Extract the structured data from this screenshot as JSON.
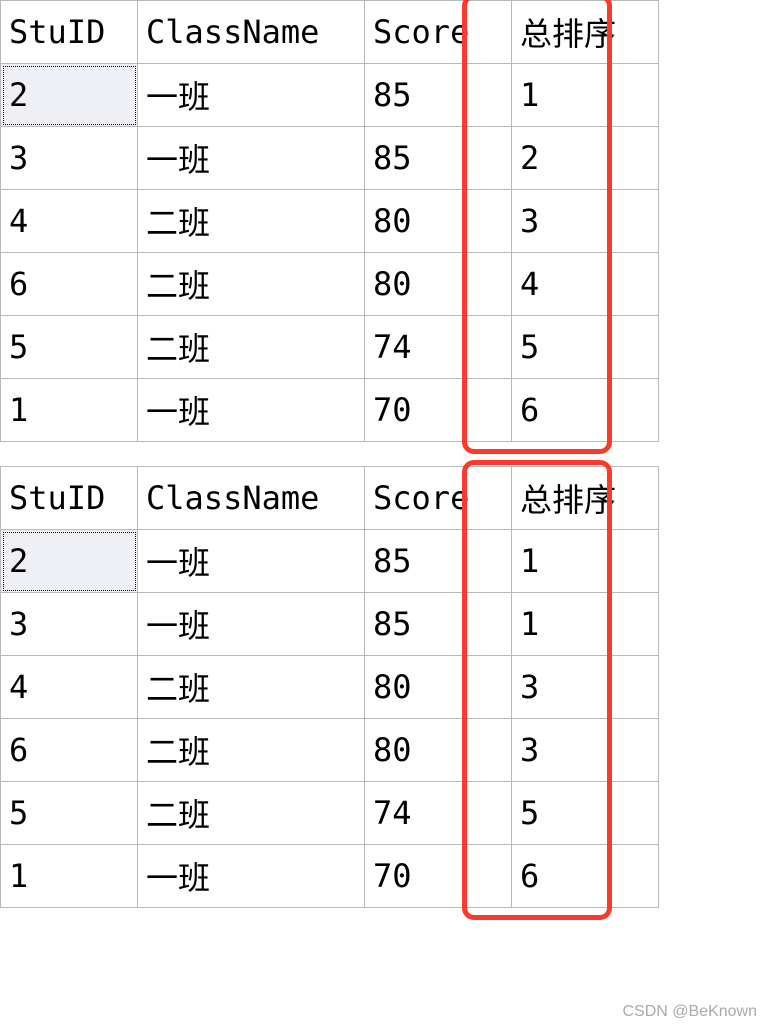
{
  "table1": {
    "headers": [
      "StuID",
      "ClassName",
      "Score",
      "总排序"
    ],
    "rows": [
      {
        "StuID": "2",
        "ClassName": "一班",
        "Score": "85",
        "Rank": "1"
      },
      {
        "StuID": "3",
        "ClassName": "一班",
        "Score": "85",
        "Rank": "2"
      },
      {
        "StuID": "4",
        "ClassName": "二班",
        "Score": "80",
        "Rank": "3"
      },
      {
        "StuID": "6",
        "ClassName": "二班",
        "Score": "80",
        "Rank": "4"
      },
      {
        "StuID": "5",
        "ClassName": "二班",
        "Score": "74",
        "Rank": "5"
      },
      {
        "StuID": "1",
        "ClassName": "一班",
        "Score": "70",
        "Rank": "6"
      }
    ]
  },
  "table2": {
    "headers": [
      "StuID",
      "ClassName",
      "Score",
      "总排序"
    ],
    "rows": [
      {
        "StuID": "2",
        "ClassName": "一班",
        "Score": "85",
        "Rank": "1"
      },
      {
        "StuID": "3",
        "ClassName": "一班",
        "Score": "85",
        "Rank": "1"
      },
      {
        "StuID": "4",
        "ClassName": "二班",
        "Score": "80",
        "Rank": "3"
      },
      {
        "StuID": "6",
        "ClassName": "二班",
        "Score": "80",
        "Rank": "3"
      },
      {
        "StuID": "5",
        "ClassName": "二班",
        "Score": "74",
        "Rank": "5"
      },
      {
        "StuID": "1",
        "ClassName": "一班",
        "Score": "70",
        "Rank": "6"
      }
    ]
  },
  "watermark": "CSDN @BeKnown"
}
